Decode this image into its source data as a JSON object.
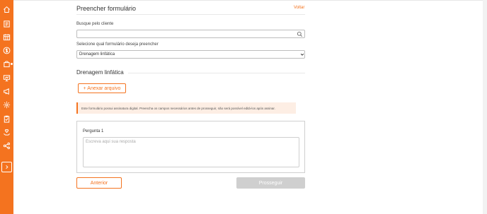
{
  "colors": {
    "accent": "#f4731f",
    "sidebar": "#f4731f",
    "notice_bg": "#fdeee4",
    "disabled": "#cfcfcf"
  },
  "sidebar": {
    "items": [
      {
        "icon": "home-icon"
      },
      {
        "icon": "clipboard-list-icon"
      },
      {
        "icon": "calendar-icon"
      },
      {
        "icon": "dollar-circle-icon"
      },
      {
        "icon": "shopping-bag-icon"
      },
      {
        "icon": "presentation-icon"
      },
      {
        "icon": "megaphone-icon"
      },
      {
        "icon": "settings-gear-icon"
      },
      {
        "icon": "clipboard-check-icon"
      },
      {
        "icon": "hand-heart-icon"
      },
      {
        "icon": "share-icon"
      }
    ],
    "expand_icon": "chevron-right-icon"
  },
  "header": {
    "title": "Preencher formulário",
    "back_label": "Voltar"
  },
  "client_search": {
    "label": "Busque pelo cliente",
    "value": "",
    "placeholder": ""
  },
  "form_select": {
    "label": "Selecione qual formulário deseja preencher",
    "selected": "Drenagem linfática"
  },
  "section": {
    "title": "Drenagem linfática"
  },
  "attach_button": {
    "label": "+ Anexar arquivo"
  },
  "notice": {
    "text": "Este formulário possui assinatura digital. Preencha os campos necessários antes de prosseguir, não será possível editá-los após assinar."
  },
  "question": {
    "label": "Pergunta 1",
    "placeholder": "Escreva aqui sua resposta",
    "value": ""
  },
  "footer": {
    "prev_label": "Anterior",
    "next_label": "Prosseguir"
  }
}
